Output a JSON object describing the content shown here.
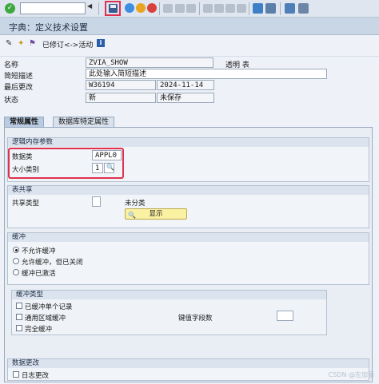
{
  "toolbar": {
    "ok_icon": "checkmark-icon",
    "command_field_value": "",
    "save_icon": "save-disk-icon",
    "nav_icons": [
      "back-icon",
      "exit-icon",
      "cancel-icon"
    ]
  },
  "title": "字典：定义技术设置",
  "app_toolbar": {
    "revised_active_label": "已修订<->活动"
  },
  "header": {
    "name_label": "名称",
    "name_value": "ZVIA_SHOW",
    "name_type": "透明 表",
    "short_desc_label": "简短描述",
    "short_desc_value": "此处输入简短描述",
    "last_changed_label": "最后更改",
    "last_changed_user": "W36194",
    "last_changed_date": "2024-11-14",
    "status_label": "状态",
    "status_value": "新",
    "status_saved": "未保存"
  },
  "tabs": [
    {
      "label": "常规属性",
      "active": true
    },
    {
      "label": "数据库特定属性",
      "active": false
    }
  ],
  "logical_storage": {
    "title": "逻辑内存参数",
    "data_class_label": "数据类",
    "data_class_value": "APPL0",
    "size_class_label": "大小类别",
    "size_class_value": "1"
  },
  "table_sharing": {
    "title": "表共享",
    "share_type_label": "共享类型",
    "share_type_value": "未分类",
    "display_button": "显示"
  },
  "buffering": {
    "title": "缓冲",
    "options": [
      {
        "label": "不允许缓冲",
        "selected": true
      },
      {
        "label": "允许缓冲，但已关闭",
        "selected": false
      },
      {
        "label": "缓冲已激活",
        "selected": false
      }
    ]
  },
  "buffer_type": {
    "title": "缓冲类型",
    "options": [
      "已缓冲单个记录",
      "通用区域缓冲",
      "完全缓冲"
    ],
    "key_fields_label": "键值字段数"
  },
  "data_change": {
    "title": "数据更改",
    "log_changes_label": "日志更改"
  },
  "watermark": "CSDN @左加丽"
}
